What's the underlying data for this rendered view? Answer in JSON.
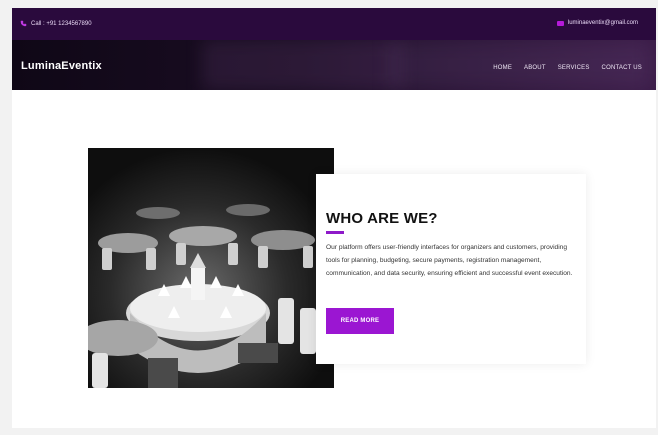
{
  "topbar": {
    "call_text": "Call : +91 1234567890",
    "email_text": "luminaeventix@gmail.com",
    "phone_icon": "phone-icon",
    "mail_icon": "mail-icon"
  },
  "navbar": {
    "brand": "LuminaEventix",
    "menu": [
      "HOME",
      "ABOUT",
      "SERVICES",
      "CONTACT US"
    ]
  },
  "about": {
    "title": "WHO ARE WE?",
    "body": "Our platform offers user-friendly interfaces for organizers and customers, providing tools for planning, budgeting, secure payments, registration management, communication, and data security, ensuring efficient and successful event execution.",
    "button_label": "READ MORE",
    "image_subject": "banquet-hall-photo"
  },
  "colors": {
    "topbar_bg": "#2a0a3d",
    "accent": "#9b16d2"
  }
}
